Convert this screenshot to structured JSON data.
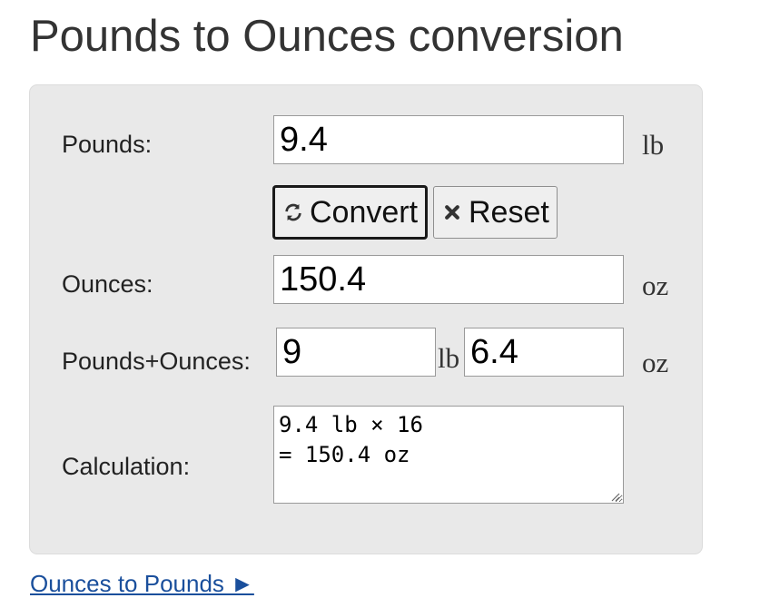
{
  "header": {
    "title": "Pounds to Ounces conversion"
  },
  "form": {
    "pounds_label": "Pounds:",
    "pounds_value": "9.4",
    "pounds_unit": "lb",
    "convert_label": "Convert",
    "reset_label": "Reset",
    "ounces_label": "Ounces:",
    "ounces_value": "150.4",
    "ounces_unit": "oz",
    "combo_label": "Pounds+Ounces:",
    "combo_pounds_value": "9",
    "combo_pounds_unit": "lb",
    "combo_ounces_value": "6.4",
    "combo_ounces_unit": "oz",
    "calc_label": "Calculation:",
    "calc_value": "9.4 lb × 16\n= 150.4 oz"
  },
  "links": {
    "ounces_to_pounds": "Ounces to Pounds ►"
  },
  "icons": {
    "convert": "refresh-icon",
    "reset": "close-icon"
  },
  "colors": {
    "panel_bg": "#e9e9e9",
    "link": "#1a4f9c"
  }
}
